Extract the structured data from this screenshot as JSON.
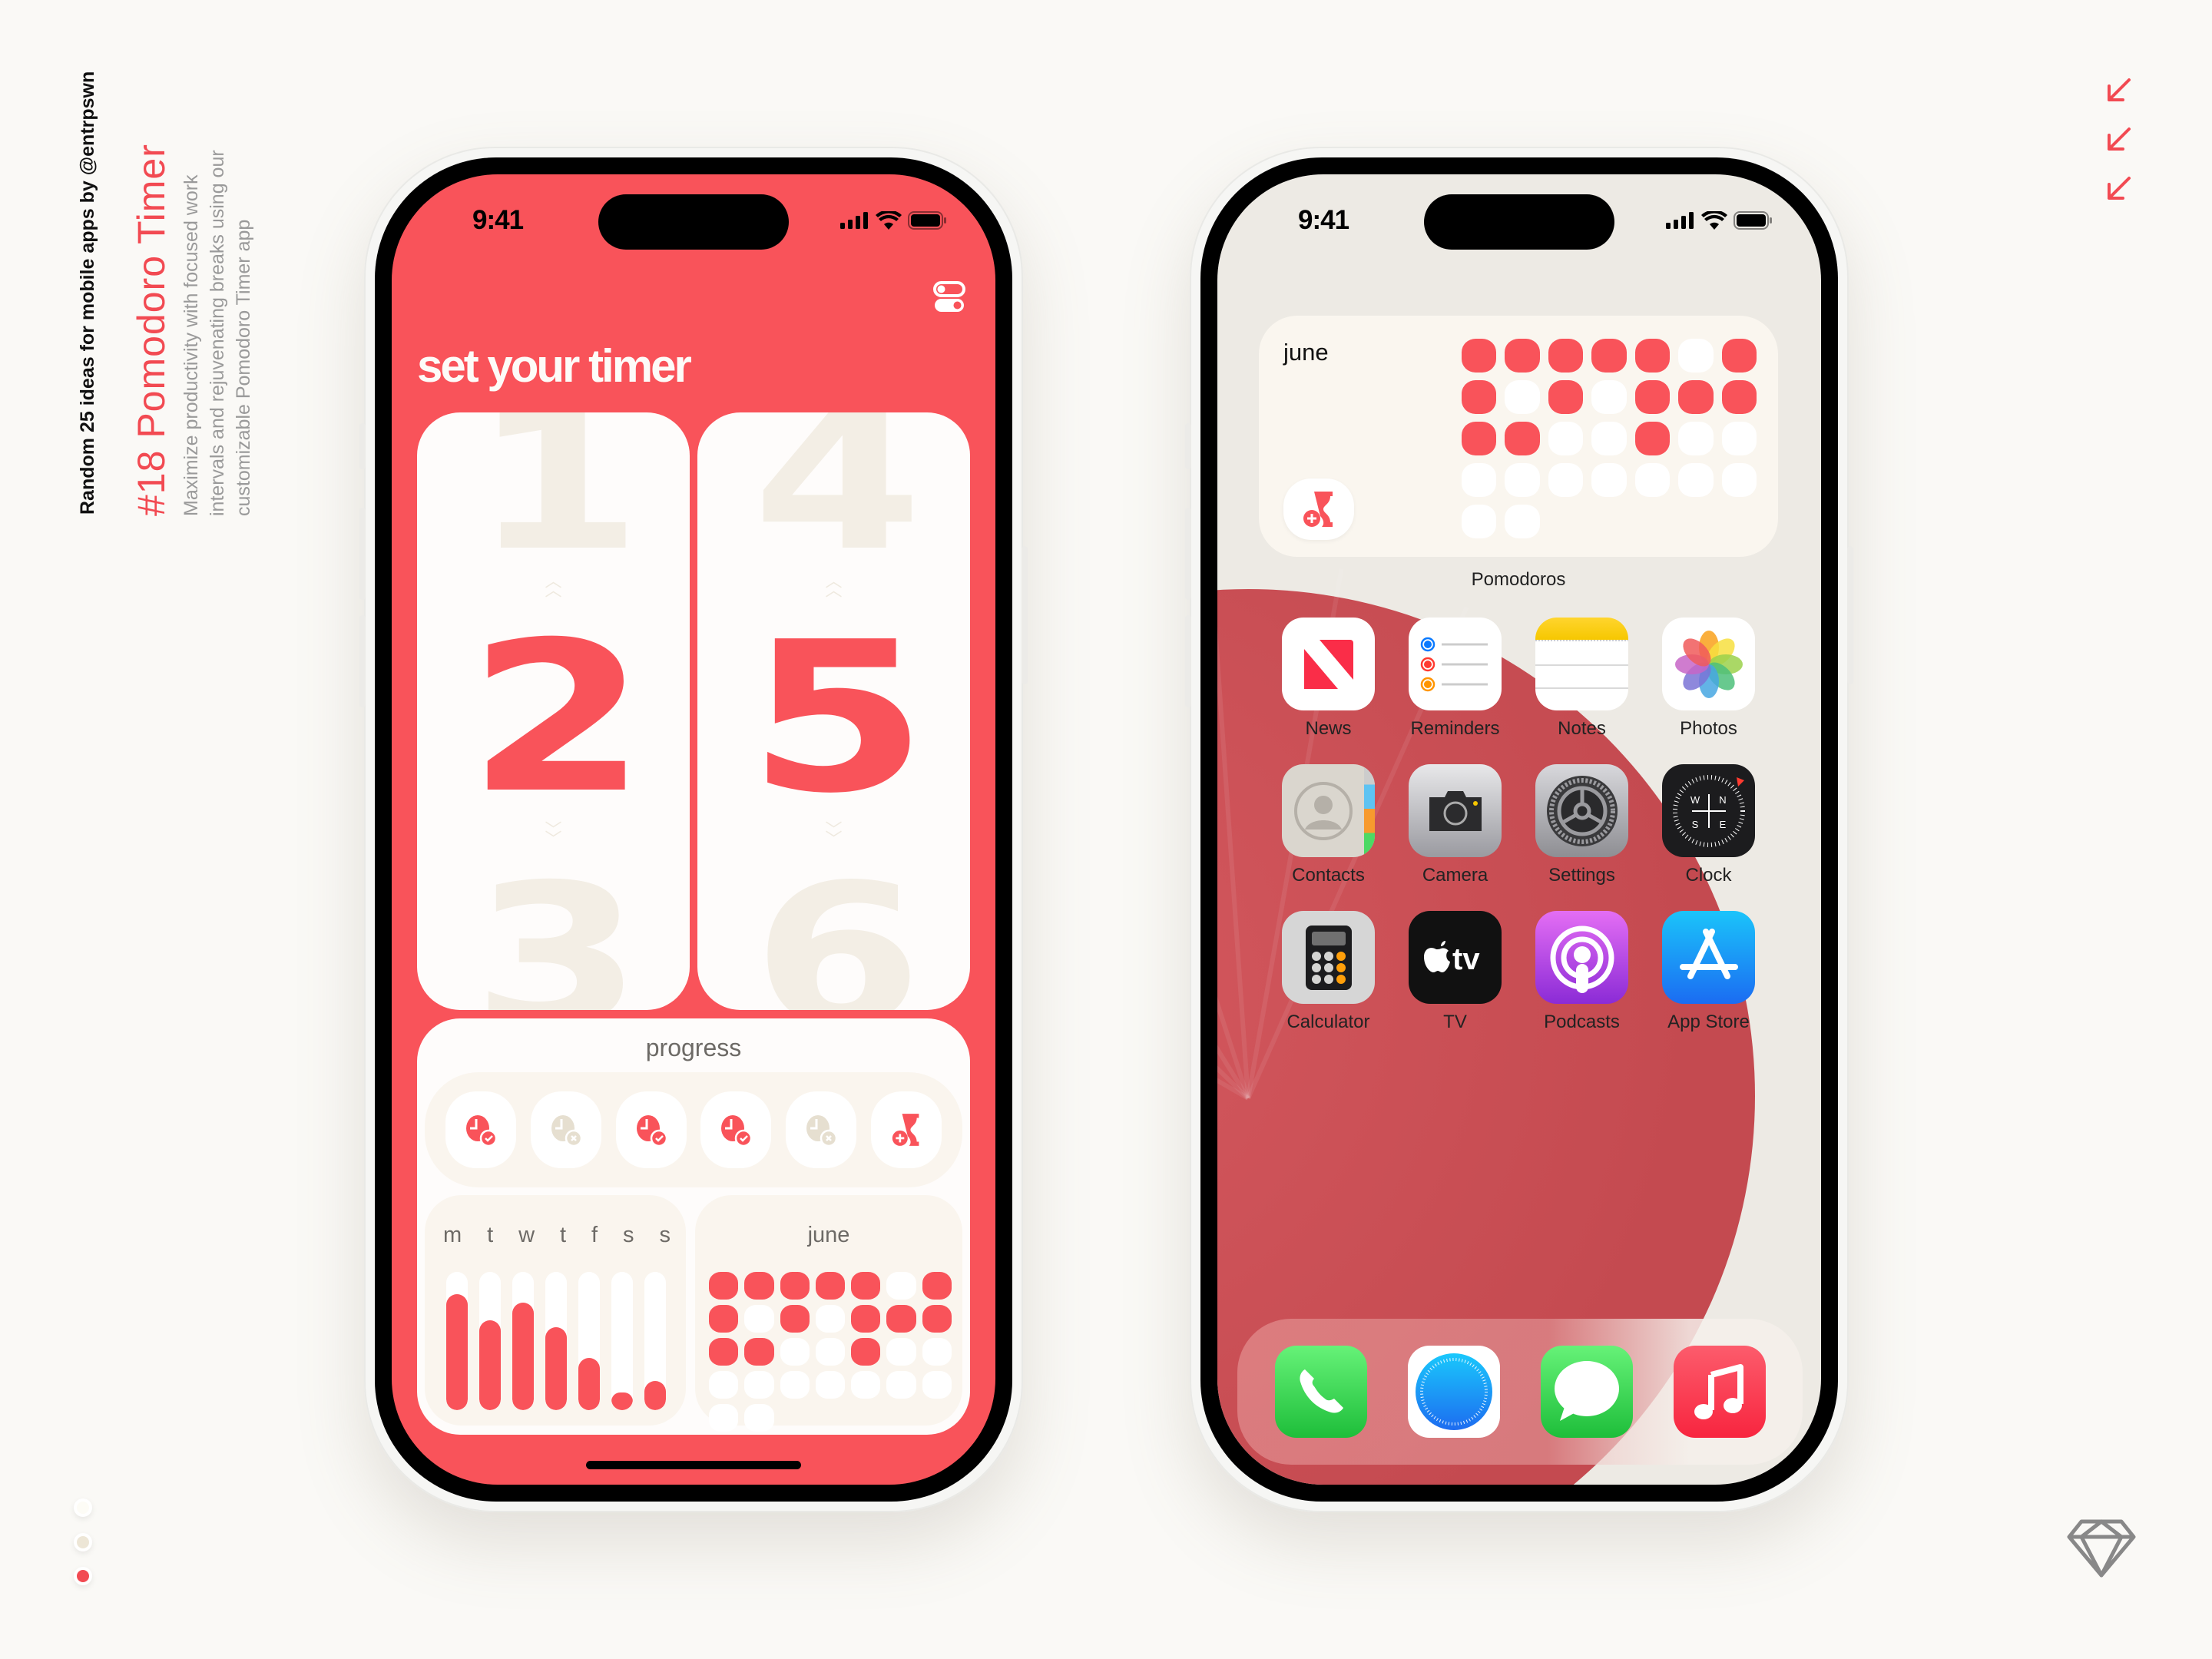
{
  "side": {
    "subtitle": "Random 25 ideas for mobile apps by @entrpswn",
    "title": "#18 Pomodoro Timer",
    "description": "Maximize productivity with focused work intervals and rejuvenating breaks using our customizable Pomodoro Timer app"
  },
  "palette": [
    "#FDFCF6",
    "#EDE6D6",
    "#F24A52"
  ],
  "accent": "#F9535A",
  "decor": {
    "arrow_icon": "arrow-down-left-icon",
    "brand_icon": "sketch-diamond-icon"
  },
  "status": {
    "time": "9:41",
    "icons": [
      "signal-icon",
      "wifi-icon",
      "battery-icon"
    ]
  },
  "timer_app": {
    "heading": "set your timer",
    "settings_icon": "toggle-icon",
    "minutes_tens": {
      "above": "1",
      "current": "2",
      "below": "3"
    },
    "minutes_ones": {
      "above": "4",
      "current": "5",
      "below": "6"
    },
    "progress": {
      "title": "progress",
      "sessions": [
        {
          "status": "completed",
          "icon": "clock-check-icon"
        },
        {
          "status": "skipped",
          "icon": "clock-x-icon"
        },
        {
          "status": "completed",
          "icon": "clock-check-icon"
        },
        {
          "status": "completed",
          "icon": "clock-check-icon"
        },
        {
          "status": "skipped",
          "icon": "clock-x-icon"
        },
        {
          "status": "add",
          "icon": "hourglass-add-icon"
        }
      ],
      "week": {
        "days": [
          "m",
          "t",
          "w",
          "t",
          "f",
          "s",
          "s"
        ],
        "values": [
          0.84,
          0.65,
          0.78,
          0.6,
          0.38,
          0.13,
          0.21
        ]
      },
      "month": {
        "title": "june",
        "days": 30,
        "completed_days": [
          1,
          2,
          3,
          4,
          5,
          7,
          8,
          10,
          12,
          13,
          14,
          15,
          16,
          19
        ]
      }
    }
  },
  "home_screen": {
    "widget": {
      "title": "june",
      "label": "Pomodoros",
      "add_icon": "hourglass-add-icon",
      "days": 30,
      "completed_days": [
        1,
        2,
        3,
        4,
        5,
        7,
        8,
        10,
        12,
        13,
        14,
        15,
        16,
        19
      ]
    },
    "apps": [
      {
        "label": "News",
        "icon": "news-icon"
      },
      {
        "label": "Reminders",
        "icon": "reminders-icon"
      },
      {
        "label": "Notes",
        "icon": "notes-icon"
      },
      {
        "label": "Photos",
        "icon": "photos-icon"
      },
      {
        "label": "Contacts",
        "icon": "contacts-icon"
      },
      {
        "label": "Camera",
        "icon": "camera-icon"
      },
      {
        "label": "Settings",
        "icon": "settings-icon"
      },
      {
        "label": "Clock",
        "icon": "clock-icon"
      },
      {
        "label": "Calculator",
        "icon": "calculator-icon"
      },
      {
        "label": "TV",
        "icon": "tv-icon"
      },
      {
        "label": "Podcasts",
        "icon": "podcasts-icon"
      },
      {
        "label": "App Store",
        "icon": "app-store-icon"
      }
    ],
    "dock": [
      {
        "icon": "phone-icon"
      },
      {
        "icon": "safari-icon"
      },
      {
        "icon": "messages-icon"
      },
      {
        "icon": "music-icon"
      }
    ],
    "tv_text": "tv",
    "compass_letters": [
      "W",
      "N",
      "S",
      "E"
    ]
  }
}
